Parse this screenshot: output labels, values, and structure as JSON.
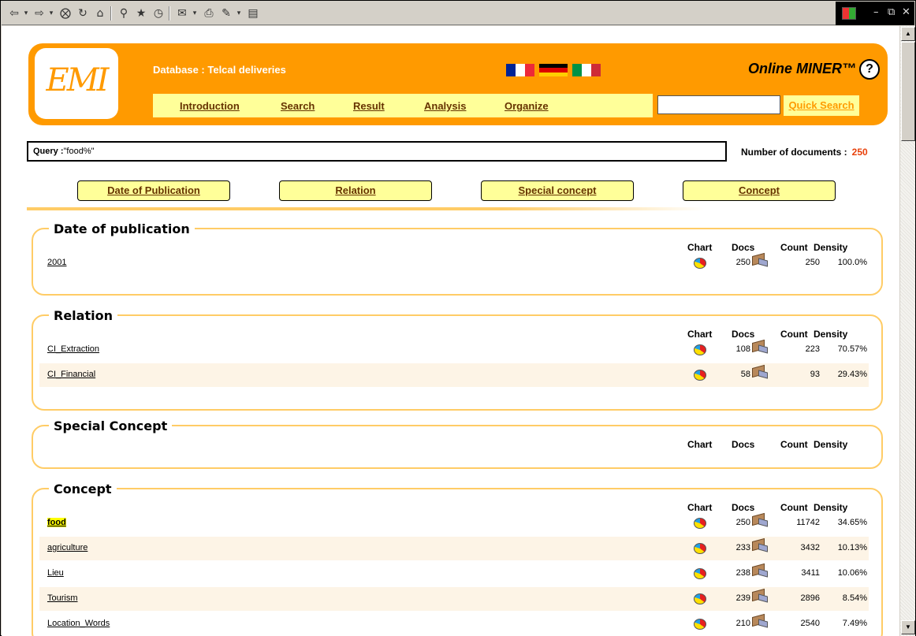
{
  "toolbar": {
    "icons": [
      "back-icon",
      "forward-icon",
      "stop-icon",
      "refresh-icon",
      "home-icon",
      "search-icon",
      "favorites-icon",
      "history-icon",
      "mail-icon",
      "print-icon",
      "edit-icon",
      "discuss-icon"
    ]
  },
  "header": {
    "logo_text": "EMI",
    "database_label": "Database : Telcal deliveries",
    "brand": "Online MINER™",
    "help_label": "?",
    "nav": [
      "Introduction",
      "Search",
      "Result",
      "Analysis",
      "Organize"
    ],
    "quick_search_value": "",
    "quick_search_label": "Quick Search"
  },
  "query": {
    "label": "Query :",
    "value": "\"food%\"",
    "num_docs_label": "Number of documents :",
    "num_docs_value": "250"
  },
  "tabs": [
    "Date of Publication",
    "Relation",
    "Special concept",
    "Concept"
  ],
  "columns": {
    "chart": "Chart",
    "docs": "Docs",
    "count": "Count",
    "density": "Density"
  },
  "sections": [
    {
      "title": "Date of publication",
      "rows": [
        {
          "label": "2001",
          "docs": "250",
          "count": "250",
          "density": "100.0%"
        }
      ]
    },
    {
      "title": "Relation",
      "rows": [
        {
          "label": "CI_Extraction",
          "docs": "108",
          "count": "223",
          "density": "70.57%"
        },
        {
          "label": "CI_Financial",
          "docs": "58",
          "count": "93",
          "density": "29.43%"
        }
      ]
    },
    {
      "title": "Special Concept",
      "rows": []
    },
    {
      "title": "Concept",
      "rows": [
        {
          "label": "food",
          "docs": "250",
          "count": "11742",
          "density": "34.65%",
          "highlight": true
        },
        {
          "label": "agriculture",
          "docs": "233",
          "count": "3432",
          "density": "10.13%"
        },
        {
          "label": "Lieu",
          "docs": "238",
          "count": "3411",
          "density": "10.06%"
        },
        {
          "label": "Tourism",
          "docs": "239",
          "count": "2896",
          "density": "8.54%"
        },
        {
          "label": "Location_Words",
          "docs": "210",
          "count": "2540",
          "density": "7.49%"
        }
      ]
    }
  ],
  "colors": {
    "accent": "#ff9a00",
    "nav_bg": "#ffff99",
    "row_alt": "#fdf4e6",
    "section_border": "#ffcc66",
    "doc_count": "#e8400a"
  }
}
